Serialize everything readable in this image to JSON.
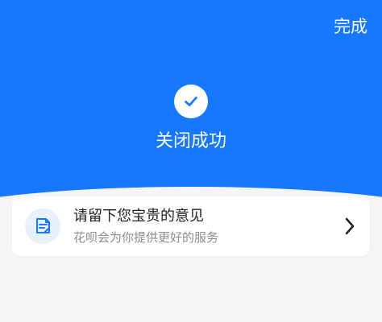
{
  "header": {
    "done_label": "完成"
  },
  "status": {
    "icon": "check-icon",
    "text": "关闭成功"
  },
  "feedback": {
    "icon": "feedback-edit-icon",
    "title": "请留下您宝贵的意见",
    "subtitle": "花呗会为你提供更好的服务",
    "chevron_icon": "chevron-right-icon"
  },
  "colors": {
    "primary": "#1677ff",
    "background": "#f5f5f7",
    "card": "#ffffff",
    "title_text": "#222222",
    "subtitle_text": "#8c8c8c"
  }
}
